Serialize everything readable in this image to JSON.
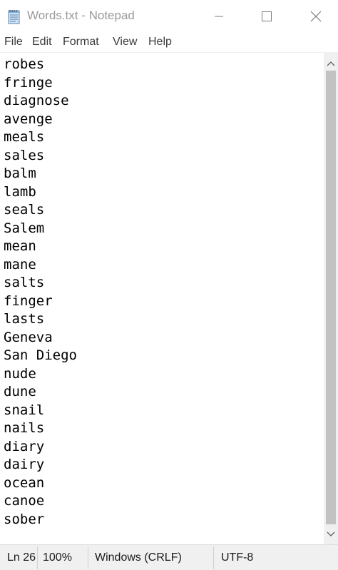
{
  "window": {
    "title": "Words.txt - Notepad"
  },
  "menu": {
    "file": "File",
    "edit": "Edit",
    "format": "Format",
    "view": "View",
    "help": "Help"
  },
  "editor": {
    "lines": [
      "robes",
      "fringe",
      "diagnose",
      "avenge",
      "meals",
      "sales",
      "balm",
      "lamb",
      "seals",
      "Salem",
      "mean",
      "mane",
      "salts",
      "finger",
      "lasts",
      "Geneva",
      "San Diego",
      "nude",
      "dune",
      "snail",
      "nails",
      "diary",
      "dairy",
      "ocean",
      "canoe",
      "sober"
    ]
  },
  "status": {
    "line": "Ln 26",
    "zoom": "100%",
    "line_ending": "Windows (CRLF)",
    "encoding": "UTF-8"
  },
  "icons": {
    "app": "notepad-icon",
    "minimize": "minimize-icon",
    "maximize": "maximize-icon",
    "close": "close-icon",
    "scroll_up": "chevron-up-icon",
    "scroll_down": "chevron-down-icon"
  }
}
